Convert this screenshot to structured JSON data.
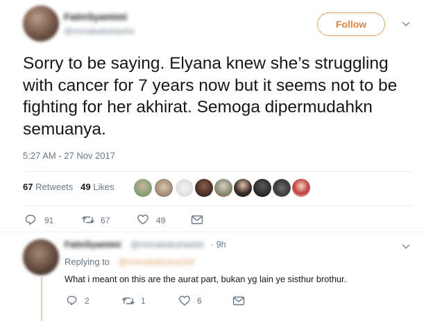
{
  "tweet": {
    "display_name": "FatinSyamimi",
    "handle": "@mimababuhashd",
    "follow_label": "Follow",
    "text": "Sorry to be saying. Elyana knew she’s struggling with cancer for 7 years now but it seems not to be fighting for her akhirat. Semoga dipermudahkn semuanya.",
    "timestamp": "5:27 AM - 27 Nov 2017",
    "retweets_count": "67",
    "retweets_label": "Retweets",
    "likes_count": "49",
    "likes_label": "Likes",
    "actions": {
      "reply_count": "91",
      "retweet_count": "67",
      "like_count": "49"
    }
  },
  "reply": {
    "display_name": "FatinSyamimi",
    "handle": "@mimababuhashd",
    "time": "· 9h",
    "replying_to_label": "Replying to",
    "replying_to_handle": "@mimababuhashd",
    "text": "What i meant on this are the aurat part, bukan yg lain ye sisthur brothur.",
    "actions": {
      "reply_count": "2",
      "retweet_count": "1",
      "like_count": "6"
    }
  },
  "colors": {
    "accent": "#e0a068",
    "muted_text": "#657786",
    "primary_text": "#14171a",
    "divider": "#e6ecf0"
  },
  "icons": [
    "caret-down-icon",
    "reply-icon",
    "retweet-icon",
    "heart-icon",
    "dm-envelope-icon"
  ]
}
